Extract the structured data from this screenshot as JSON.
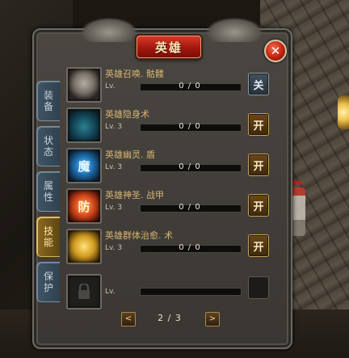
{
  "window": {
    "title": "英雄",
    "close_icon": "✕"
  },
  "tabs": [
    {
      "label": [
        "装",
        "备"
      ],
      "active": false
    },
    {
      "label": [
        "状",
        "态"
      ],
      "active": false
    },
    {
      "label": [
        "属",
        "性"
      ],
      "active": false
    },
    {
      "label": [
        "技",
        "能"
      ],
      "active": true
    },
    {
      "label": [
        "保",
        "护"
      ],
      "active": false
    }
  ],
  "skills": [
    {
      "name": "英雄召唤. 骷髅",
      "level": "Lv.",
      "progress": "0 / 0",
      "toggle": "关",
      "toggle_state": "off",
      "icon": "skull-icon"
    },
    {
      "name": "英雄隐身术",
      "level": "Lv. 3",
      "progress": "0 / 0",
      "toggle": "开",
      "toggle_state": "on",
      "icon": "figure-icon"
    },
    {
      "name": "英雄幽灵. 盾",
      "level": "Lv. 3",
      "progress": "0 / 0",
      "toggle": "开",
      "toggle_state": "on",
      "icon": "magic-shield-icon",
      "icon_glyph": "魔"
    },
    {
      "name": "英雄神圣. 战甲",
      "level": "Lv. 3",
      "progress": "0 / 0",
      "toggle": "开",
      "toggle_state": "on",
      "icon": "holy-armor-icon",
      "icon_glyph": "防"
    },
    {
      "name": "英雄群体治愈. 术",
      "level": "Lv. 3",
      "progress": "0 / 0",
      "toggle": "开",
      "toggle_state": "on",
      "icon": "group-heal-icon"
    },
    {
      "name": "",
      "level": "Lv.",
      "progress": "",
      "toggle": "",
      "toggle_state": "empty",
      "icon": "lock-icon"
    }
  ],
  "pager": {
    "prev": "<",
    "next": ">",
    "text": "2 / 3"
  },
  "colors": {
    "accent_gold": "#d7b673",
    "title_red": "#c62a1c",
    "tab_active": "#8a6a22"
  }
}
